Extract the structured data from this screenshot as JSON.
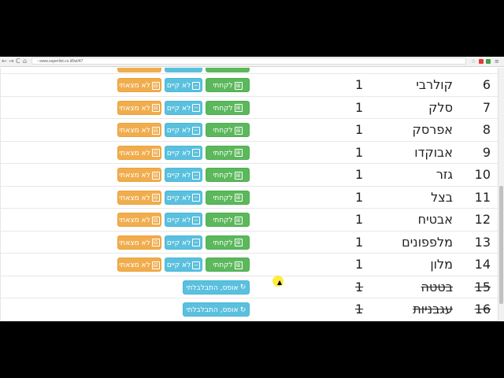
{
  "browser": {
    "url": "www.superlist.co.il/list/47",
    "nav_back": "←",
    "nav_forward": "→",
    "nav_reload": "C",
    "nav_home": "⌂",
    "page_icon": "▫",
    "bookmark_icon": "☆",
    "menu_icon": "≡"
  },
  "labels": {
    "took": "לקחתי",
    "none": "לא קיים",
    "not_found": "לא מצאתי",
    "undo": "אופס, התבלבלתי"
  },
  "icons": {
    "took": "⊞",
    "none": "−",
    "not_found": "⊟",
    "undo": "↻"
  },
  "items": [
    {
      "num": "6",
      "name": "קולרבי",
      "qty": "1"
    },
    {
      "num": "7",
      "name": "סלק",
      "qty": "1"
    },
    {
      "num": "8",
      "name": "אפרסק",
      "qty": "1"
    },
    {
      "num": "9",
      "name": "אבוקדו",
      "qty": "1"
    },
    {
      "num": "10",
      "name": "גזר",
      "qty": "1"
    },
    {
      "num": "11",
      "name": "בצל",
      "qty": "1"
    },
    {
      "num": "12",
      "name": "אבטיח",
      "qty": "1"
    },
    {
      "num": "13",
      "name": "מלפפונים",
      "qty": "1"
    },
    {
      "num": "14",
      "name": "מלון",
      "qty": "1"
    }
  ],
  "done_items": [
    {
      "num": "15",
      "name": "בטטה",
      "qty": "1"
    },
    {
      "num": "16",
      "name": "עגבניות",
      "qty": "1"
    }
  ]
}
